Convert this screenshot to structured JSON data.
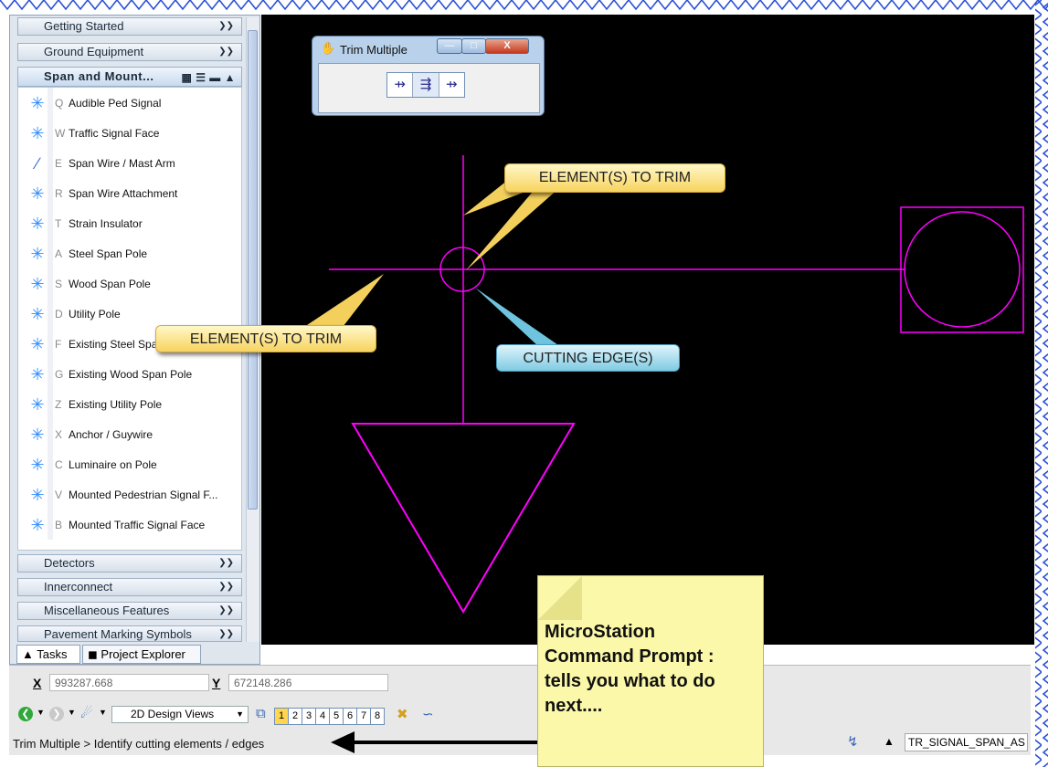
{
  "task_panel": {
    "groups_top": [
      "Getting Started",
      "Ground Equipment"
    ],
    "open_group": "Span and Mount...",
    "items": [
      {
        "key": "Q",
        "label": "Audible Ped Signal"
      },
      {
        "key": "W",
        "label": "Traffic Signal Face"
      },
      {
        "key": "E",
        "label": "Span Wire / Mast Arm"
      },
      {
        "key": "R",
        "label": "Span Wire Attachment"
      },
      {
        "key": "T",
        "label": "Strain Insulator"
      },
      {
        "key": "A",
        "label": "Steel Span Pole"
      },
      {
        "key": "S",
        "label": "Wood Span Pole"
      },
      {
        "key": "D",
        "label": "Utility Pole"
      },
      {
        "key": "F",
        "label": "Existing Steel Span"
      },
      {
        "key": "G",
        "label": "Existing Wood Span Pole"
      },
      {
        "key": "Z",
        "label": "Existing Utility  Pole"
      },
      {
        "key": "X",
        "label": "Anchor / Guywire"
      },
      {
        "key": "C",
        "label": "Luminaire on Pole"
      },
      {
        "key": "V",
        "label": "Mounted Pedestrian Signal F..."
      },
      {
        "key": "B",
        "label": "Mounted Traffic Signal Face"
      }
    ],
    "groups_bottom": [
      "Detectors",
      "Innerconnect",
      "Miscellaneous Features",
      "Pavement Marking Symbols"
    ],
    "tabs": [
      "Tasks",
      "Project Explorer"
    ]
  },
  "dialog": {
    "title": "Trim Multiple"
  },
  "callouts": {
    "trim_top": "ELEMENT(S) TO TRIM",
    "trim_left": "ELEMENT(S) TO TRIM",
    "cutting": "CUTTING EDGE(S)"
  },
  "coords": {
    "x_label": "X",
    "x_value": "993287.668",
    "y_label": "Y",
    "y_value": "672148.286"
  },
  "toolbar": {
    "view_select": "2D Design Views",
    "views": [
      "1",
      "2",
      "3",
      "4",
      "5",
      "6",
      "7",
      "8"
    ],
    "active_view": "1"
  },
  "prompt": "Trim Multiple > Identify cutting elements / edges",
  "status": {
    "level": "TR_SIGNAL_SPAN_AS"
  },
  "note": {
    "lines": [
      "MicroStation",
      "Command Prompt :",
      "tells you what to do",
      "next...."
    ]
  },
  "colors": {
    "element": "#ff00ff",
    "canvas": "#000000",
    "note": "#fbf8a9"
  }
}
